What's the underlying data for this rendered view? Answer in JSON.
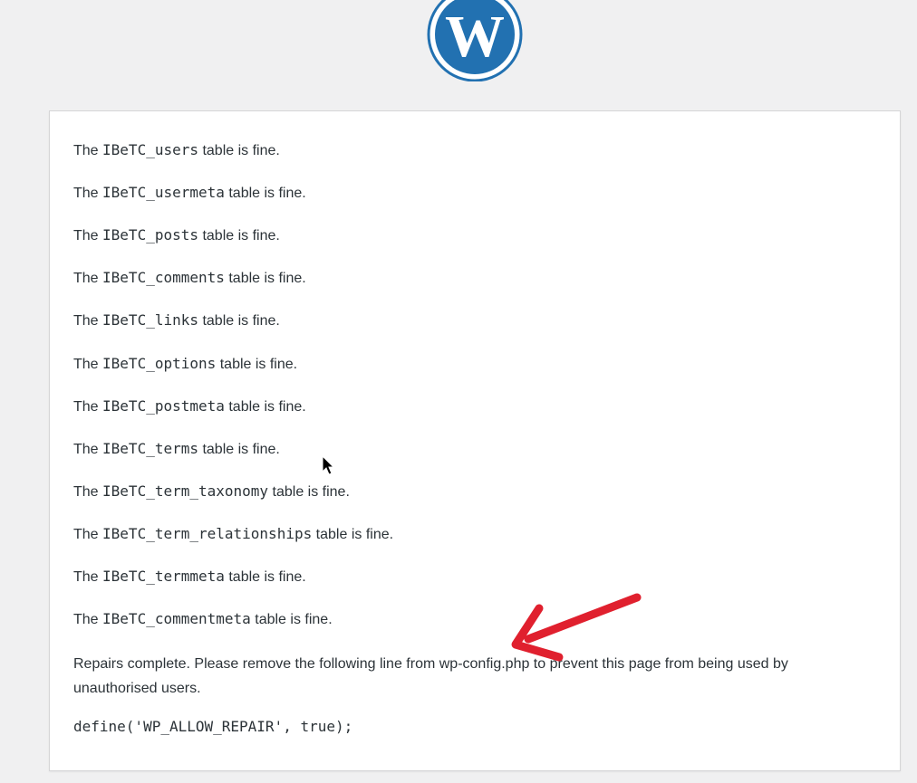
{
  "logo": {
    "icon": "wordpress-logo",
    "color": "#2271b1"
  },
  "results": [
    {
      "prefix": "The",
      "table": "IBeTC_users",
      "suffix": "table is fine."
    },
    {
      "prefix": "The",
      "table": "IBeTC_usermeta",
      "suffix": "table is fine."
    },
    {
      "prefix": "The",
      "table": "IBeTC_posts",
      "suffix": "table is fine."
    },
    {
      "prefix": "The",
      "table": "IBeTC_comments",
      "suffix": "table is fine."
    },
    {
      "prefix": "The",
      "table": "IBeTC_links",
      "suffix": "table is fine."
    },
    {
      "prefix": "The",
      "table": "IBeTC_options",
      "suffix": "table is fine."
    },
    {
      "prefix": "The",
      "table": "IBeTC_postmeta",
      "suffix": "table is fine."
    },
    {
      "prefix": "The",
      "table": "IBeTC_terms",
      "suffix": "table is fine."
    },
    {
      "prefix": "The",
      "table": "IBeTC_term_taxonomy",
      "suffix": "table is fine."
    },
    {
      "prefix": "The",
      "table": "IBeTC_term_relationships",
      "suffix": "table is fine."
    },
    {
      "prefix": "The",
      "table": "IBeTC_termmeta",
      "suffix": "table is fine."
    },
    {
      "prefix": "The",
      "table": "IBeTC_commentmeta",
      "suffix": "table is fine."
    }
  ],
  "repairs_message": "Repairs complete. Please remove the following line from wp-config.php to prevent this page from being used by unauthorised users.",
  "define_line": "define('WP_ALLOW_REPAIR', true);",
  "annotation": {
    "icon": "red-arrow-annotation",
    "color": "#e0202e"
  },
  "cursor": {
    "icon": "mouse-pointer-icon"
  }
}
